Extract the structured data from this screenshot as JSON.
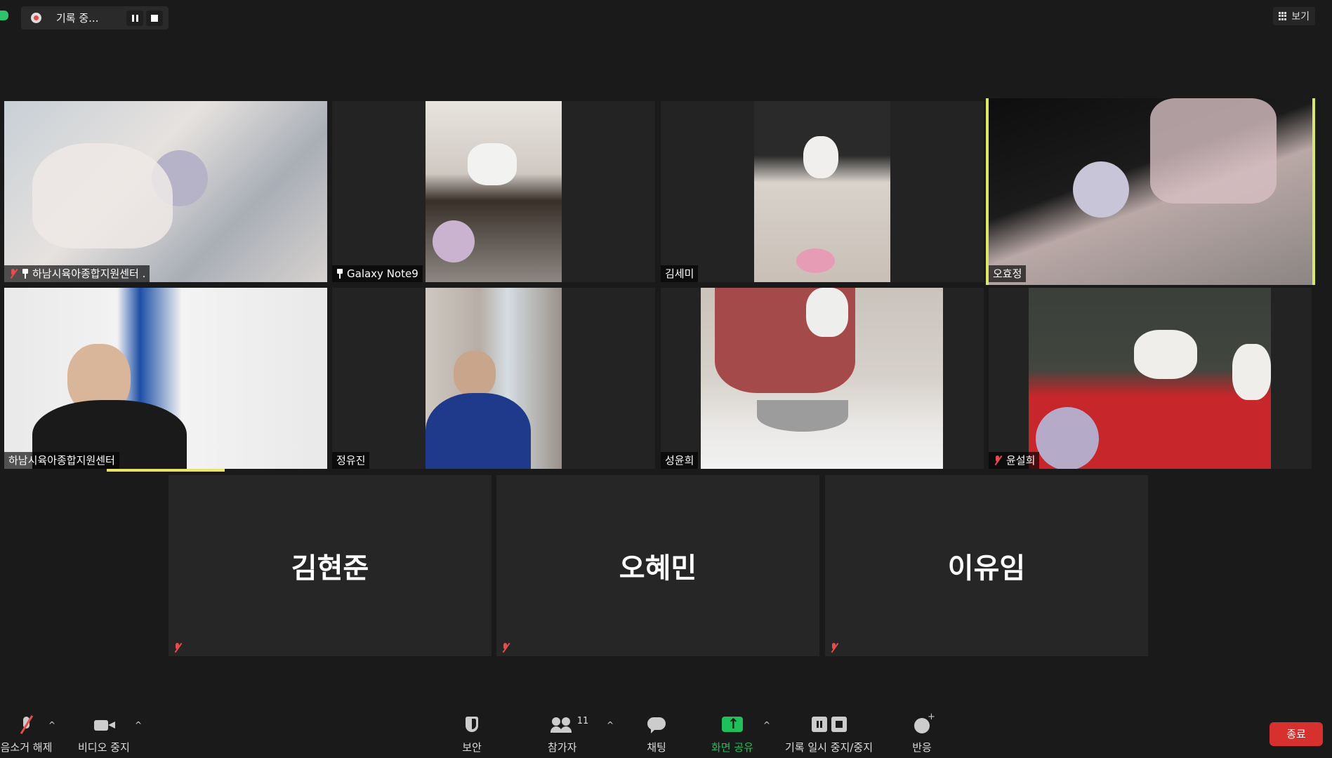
{
  "recording": {
    "label": "기록 중..."
  },
  "view": {
    "label": "보기"
  },
  "tiles": [
    {
      "name": "하남시육아종합지원센터 .",
      "muted": true,
      "pinned": true
    },
    {
      "name": "Galaxy Note9",
      "muted": false,
      "pinned": true
    },
    {
      "name": "김세미",
      "muted": false
    },
    {
      "name": "오효정",
      "muted": false,
      "active": true
    },
    {
      "name": "하남시육아종합지원센터",
      "muted": false,
      "speaking": true
    },
    {
      "name": "정유진",
      "muted": false
    },
    {
      "name": "성윤희",
      "muted": false
    },
    {
      "name": "윤설희",
      "muted": true
    }
  ],
  "name_only_tiles": [
    {
      "name": "김현준",
      "muted": true
    },
    {
      "name": "오혜민",
      "muted": true
    },
    {
      "name": "이유임",
      "muted": true
    }
  ],
  "toolbar": {
    "unmute": "음소거 해제",
    "stop_video": "비디오 중지",
    "security": "보안",
    "participants": "참가자",
    "participants_count": "11",
    "chat": "채팅",
    "share": "화면 공유",
    "record_control": "기록 일시 중지/중지",
    "reactions": "반응",
    "end": "종료"
  },
  "colors": {
    "background": "#1a1a1a",
    "active_speaker_border": "#d9e86a",
    "share_green": "#1fbf5b",
    "end_red": "#d6312f",
    "muted_red": "#e74c4c"
  }
}
